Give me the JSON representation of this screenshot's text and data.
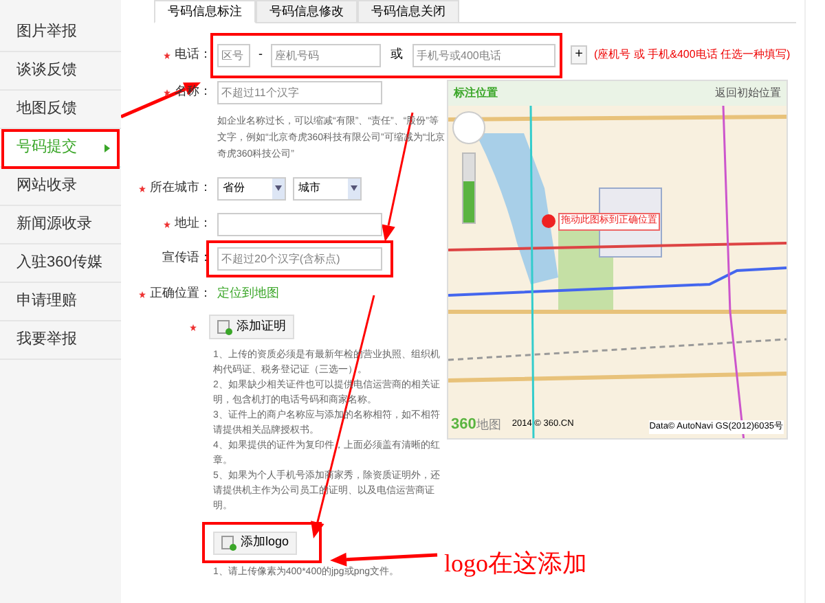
{
  "sidebar": {
    "items": [
      {
        "label": "图片举报",
        "selected": false
      },
      {
        "label": "谈谈反馈",
        "selected": false
      },
      {
        "label": "地图反馈",
        "selected": false
      },
      {
        "label": "号码提交",
        "selected": true
      },
      {
        "label": "网站收录",
        "selected": false
      },
      {
        "label": "新闻源收录",
        "selected": false
      },
      {
        "label": "入驻360传媒",
        "selected": false
      },
      {
        "label": "申请理赔",
        "selected": false
      },
      {
        "label": "我要举报",
        "selected": false
      }
    ]
  },
  "tabs": [
    {
      "label": "号码信息标注",
      "selected": true
    },
    {
      "label": "号码信息修改",
      "selected": false
    },
    {
      "label": "号码信息关闭",
      "selected": false
    }
  ],
  "form": {
    "phone": {
      "label": "电话：",
      "required": true,
      "area_placeholder": "区号",
      "separator": "-",
      "number_placeholder": "座机号码",
      "or": "或",
      "mobile_placeholder": "手机号或400电话",
      "add_button": "+",
      "hint": "(座机号 或 手机&400电话 任选一种填写)"
    },
    "name": {
      "label": "名称：",
      "required": true,
      "placeholder": "不超过11个汉字",
      "help": "如企业名称过长，可以缩减“有限”、“责任”、“股份”等文字，例如“北京奇虎360科技有限公司”可缩减为“北京奇虎360科技公司”"
    },
    "city": {
      "label": "所在城市：",
      "required": true,
      "province": "省份",
      "city": "城市"
    },
    "address": {
      "label": "地址：",
      "required": true
    },
    "slogan": {
      "label": "宣传语：",
      "required": false,
      "placeholder": "不超过20个汉字(含标点)"
    },
    "location": {
      "label": "正确位置：",
      "required": true,
      "link": "定位到地图"
    },
    "proof": {
      "button": "添加证明",
      "required": true,
      "notes": [
        "1、上传的资质必须是有最新年检的营业执照、组织机构代码证、税务登记证（三选一）。",
        "2、如果缺少相关证件也可以提供电信运营商的相关证明，包含机打的电话号码和商家名称。",
        "3、证件上的商户名称应与添加的名称相符，如不相符请提供相关品牌授权书。",
        "4、如果提供的证件为复印件，上面必须盖有清晰的红章。",
        "5、如果为个人手机号添加商家秀，除资质证明外，还请提供机主作为公司员工的证明、以及电信运营商证明。"
      ]
    },
    "logo": {
      "button": "添加logo",
      "note": "1、请上传像素为400*400的jpg或png文件。"
    }
  },
  "map": {
    "zoom": {
      "level": 0.6
    },
    "title": "标注位置",
    "reset": "返回初始位置",
    "marker_tip": "拖动此图标到正确位置",
    "brand": "360",
    "brand_suffix": "地图",
    "copyright": "2014 © 360.CN",
    "data": "Data© AutoNavi GS(2012)6035号"
  },
  "annotation": {
    "text": "logo在这添加"
  }
}
